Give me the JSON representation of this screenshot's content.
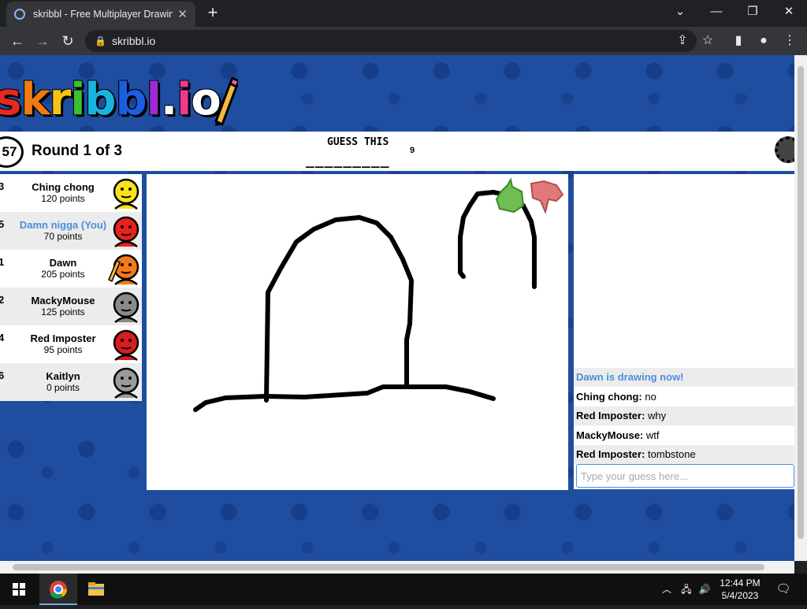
{
  "browser": {
    "tab_title": "skribbl - Free Multiplayer Drawing",
    "url": "skribbl.io",
    "window_controls": [
      "chevron-down-icon",
      "minimize-icon",
      "restore-icon",
      "close-icon"
    ]
  },
  "game": {
    "logo_letters": [
      "s",
      "k",
      "r",
      "i",
      "b",
      "b",
      "l",
      ".",
      "i",
      "o"
    ],
    "logo_colors": [
      "#e7281f",
      "#f07a14",
      "#f6c314",
      "#39c12f",
      "#18b4e0",
      "#1c5ee0",
      "#a02bd6",
      "#ffffff",
      "#ec3a8c",
      "#ffffff"
    ],
    "timer": "57",
    "round_text": "Round 1 of 3",
    "guess_label": "GUESS THIS",
    "word_blanks": "_________",
    "word_length": "9"
  },
  "players": [
    {
      "rank": "3",
      "name": "Ching chong",
      "points": "120 points",
      "avatar_color": "#f7e21b",
      "you": false,
      "drawing": false
    },
    {
      "rank": "5",
      "name": "Damn nigga (You)",
      "points": "70 points",
      "avatar_color": "#e8211d",
      "you": true,
      "drawing": false
    },
    {
      "rank": "1",
      "name": "Dawn",
      "points": "205 points",
      "avatar_color": "#f37a1a",
      "you": false,
      "drawing": true
    },
    {
      "rank": "2",
      "name": "MackyMouse",
      "points": "125 points",
      "avatar_color": "#8a8a8a",
      "you": false,
      "drawing": false
    },
    {
      "rank": "4",
      "name": "Red Imposter",
      "points": "95 points",
      "avatar_color": "#d81d20",
      "you": false,
      "drawing": false
    },
    {
      "rank": "6",
      "name": "Kaitlyn",
      "points": "0 points",
      "avatar_color": "#9a9a9a",
      "you": false,
      "drawing": false
    }
  ],
  "chat": {
    "messages": [
      {
        "type": "system",
        "text": "Dawn is drawing now!"
      },
      {
        "type": "user",
        "author": "Ching chong:",
        "text": " no"
      },
      {
        "type": "user",
        "author": "Red Imposter:",
        "text": " why"
      },
      {
        "type": "user",
        "author": "MackyMouse:",
        "text": " wtf"
      },
      {
        "type": "user",
        "author": "Red Imposter:",
        "text": " tombstone"
      }
    ],
    "input_placeholder": "Type your guess here..."
  },
  "taskbar": {
    "time": "12:44 PM",
    "date": "5/4/2023"
  }
}
